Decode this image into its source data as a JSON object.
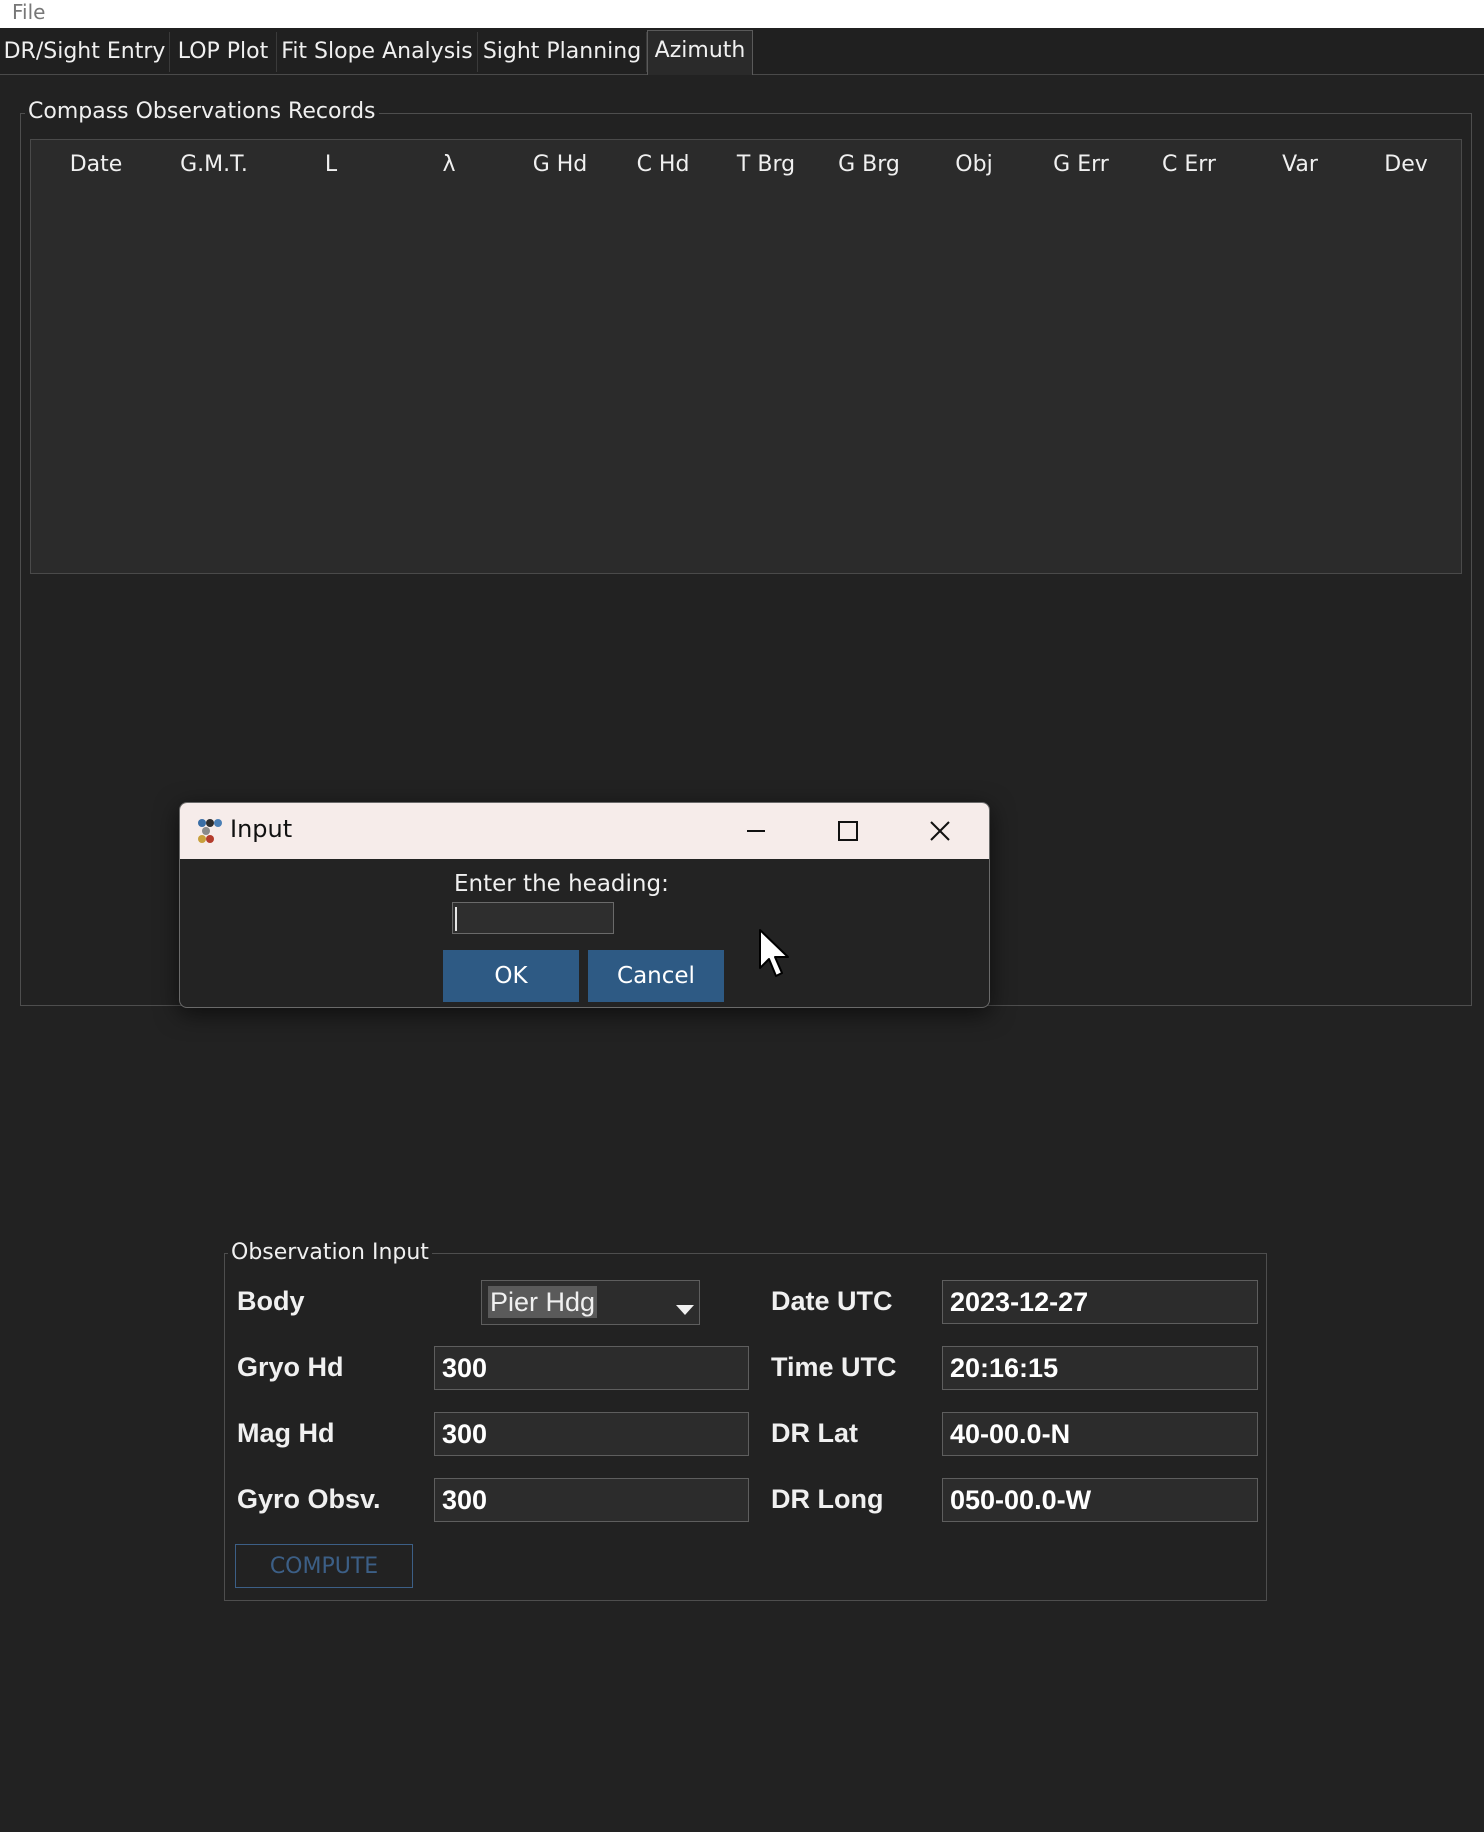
{
  "menu": {
    "file": "File"
  },
  "tabs": [
    {
      "label": "DR/Sight Entry"
    },
    {
      "label": "LOP Plot"
    },
    {
      "label": "Fit Slope Analysis"
    },
    {
      "label": "Sight Planning"
    },
    {
      "label": "Azimuth"
    }
  ],
  "records": {
    "title": "Compass Observations Records",
    "columns": [
      "Date",
      "G.M.T.",
      "L",
      "λ",
      "G Hd",
      "C Hd",
      "T Brg",
      "G Brg",
      "Obj",
      "G Err",
      "C Err",
      "Var",
      "Dev"
    ]
  },
  "dialog": {
    "title": "Input",
    "prompt": "Enter the heading:",
    "value": "",
    "ok": "OK",
    "cancel": "Cancel"
  },
  "observation": {
    "title": "Observation Input",
    "body_label": "Body",
    "body_value": "Pier Hdg",
    "gyro_hd_label": "Gryo Hd",
    "gyro_hd_value": "300",
    "mag_hd_label": "Mag Hd",
    "mag_hd_value": "300",
    "gyro_obsv_label": "Gyro Obsv.",
    "gyro_obsv_value": "300",
    "date_label": "Date UTC",
    "date_value": "2023-12-27",
    "time_label": "Time UTC",
    "time_value": "20:16:15",
    "lat_label": "DR Lat",
    "lat_value": "40-00.0-N",
    "long_label": "DR Long",
    "long_value": "050-00.0-W",
    "compute": "COMPUTE"
  },
  "colors": {
    "background": "#222222",
    "dialog_button": "#2e5a84",
    "compute_disabled": "#3c5f86"
  }
}
